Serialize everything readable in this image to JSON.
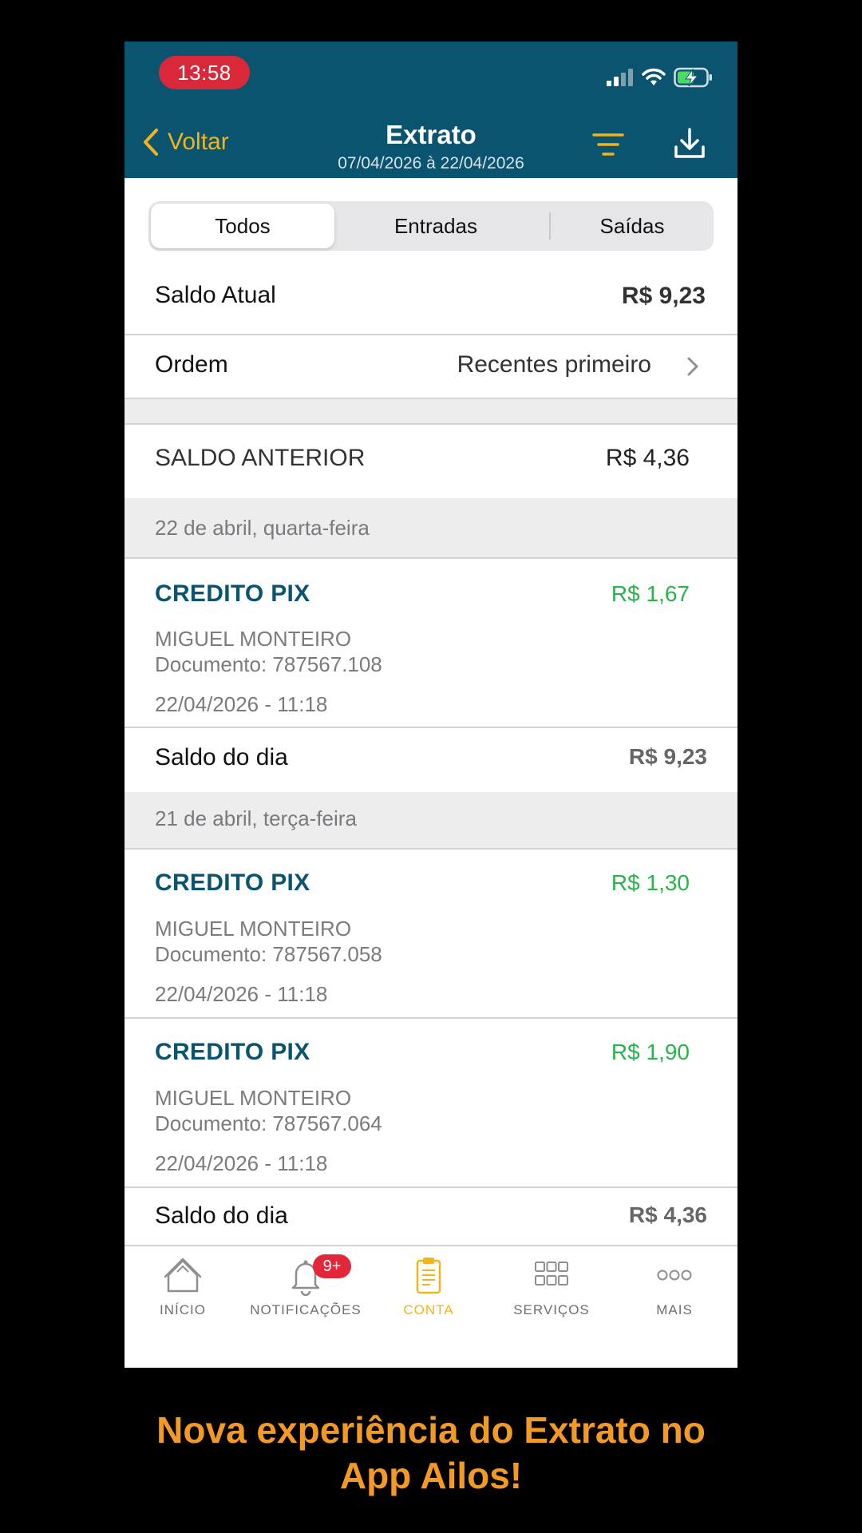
{
  "status_bar": {
    "time": "13:58"
  },
  "header": {
    "back_label": "Voltar",
    "title": "Extrato",
    "period": "07/04/2026 à 22/04/2026",
    "bg_color": "#0b5470",
    "accent_color": "#f2b41c"
  },
  "segmented": {
    "options": [
      "Todos",
      "Entradas",
      "Saídas"
    ],
    "selected": "Todos"
  },
  "summary": {
    "saldo_atual_label": "Saldo Atual",
    "saldo_atual_value": "R$ 9,23",
    "ordem_label": "Ordem",
    "ordem_value": "Recentes primeiro",
    "saldo_anterior_label": "SALDO ANTERIOR",
    "saldo_anterior_value": "R$ 4,36"
  },
  "days": [
    {
      "date_label": "22 de abril, quarta-feira",
      "transactions": [
        {
          "title": "CREDITO PIX",
          "amount": "R$ 1,67",
          "name": "MIGUEL MONTEIRO",
          "document": "Documento: 787567.108",
          "datetime": "22/04/2026 - 11:18"
        }
      ],
      "saldo_label": "Saldo do dia",
      "saldo_value": "R$ 9,23"
    },
    {
      "date_label": "21 de abril, terça-feira",
      "transactions": [
        {
          "title": "CREDITO PIX",
          "amount": "R$ 1,30",
          "name": "MIGUEL MONTEIRO",
          "document": "Documento: 787567.058",
          "datetime": "22/04/2026 - 11:18"
        },
        {
          "title": "CREDITO PIX",
          "amount": "R$ 1,90",
          "name": "MIGUEL MONTEIRO",
          "document": "Documento: 787567.064",
          "datetime": "22/04/2026 - 11:18"
        }
      ],
      "saldo_label": "Saldo do dia",
      "saldo_value": "R$ 4,36"
    }
  ],
  "tabbar": {
    "items": [
      {
        "label": "INÍCIO",
        "icon": "home-icon"
      },
      {
        "label": "NOTIFICAÇÕES",
        "icon": "bell-icon",
        "badge": "9+"
      },
      {
        "label": "CONTA",
        "icon": "clipboard-icon",
        "active": true
      },
      {
        "label": "SERVIÇOS",
        "icon": "grid-icon"
      },
      {
        "label": "MAIS",
        "icon": "more-icon"
      }
    ]
  },
  "promo": {
    "line1": "Nova experiência do Extrato no",
    "line2": "App Ailos!",
    "color": "#f39a25"
  }
}
